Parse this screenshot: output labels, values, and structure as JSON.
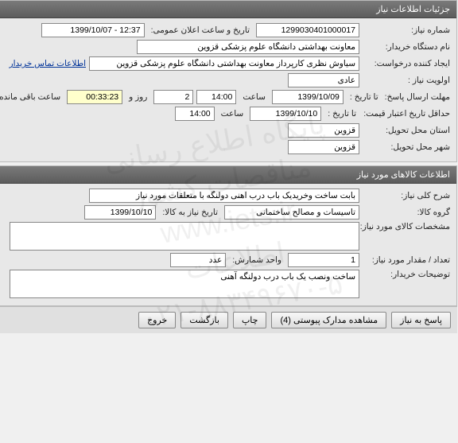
{
  "panel1": {
    "title": "جزئیات اطلاعات نیاز",
    "need_no_label": "شماره نیاز:",
    "need_no": "1299030401000017",
    "announce_date_label": "تاریخ و ساعت اعلان عمومی:",
    "announce_date": "12:37 - 1399/10/07",
    "buyer_label": "نام دستگاه خریدار:",
    "buyer": "معاونت بهداشتی دانشگاه علوم پزشکی قزوین",
    "creator_label": "ایجاد کننده درخواست:",
    "creator": "سیاوش نظری کارپرداز معاونت بهداشتی دانشگاه علوم پزشکی قزوین",
    "contact_link": "اطلاعات تماس خریدار",
    "priority_label": "اولویت نیاز :",
    "priority": "عادی",
    "deadline_label": "مهلت ارسال پاسخ:",
    "until_label": "تا تاریخ :",
    "deadline_date": "1399/10/09",
    "time_label": "ساعت",
    "deadline_time": "14:00",
    "days_remaining": "2",
    "days_and_label": "روز و",
    "time_remaining": "00:33:23",
    "remaining_label": "ساعت باقی مانده",
    "min_validity_label": "حداقل تاریخ اعتبار قیمت:",
    "min_validity_date": "1399/10/10",
    "min_validity_time": "14:00",
    "delivery_prov_label": "استان محل تحویل:",
    "delivery_prov": "قزوین",
    "delivery_city_label": "شهر محل تحویل:",
    "delivery_city": "قزوین"
  },
  "panel2": {
    "title": "اطلاعات کالاهای مورد نیاز",
    "general_desc_label": "شرح کلی نیاز:",
    "general_desc": "بابت ساخت وخریدیک باب درب آهنی دولنگه با متعلقات مورد نیاز",
    "group_label": "گروه کالا:",
    "group": "تاسیسات و مصالح ساختمانی",
    "need_date_label": "تاریخ نیاز به کالا:",
    "need_date": "1399/10/10",
    "spec_label": "مشخصات کالای مورد نیاز:",
    "spec": "",
    "qty_label": "تعداد / مقدار مورد نیاز:",
    "qty": "1",
    "unit_label": "واحد شمارش:",
    "unit": "عدد",
    "buyer_notes_label": "توضیحات خریدار:",
    "buyer_notes": "ساخت ونصب یک باب درب دولنگه آهنی"
  },
  "footer": {
    "respond": "پاسخ به نیاز",
    "attachments": "مشاهده مدارک پیوستی (4)",
    "print": "چاپ",
    "back": "بازگشت",
    "exit": "خروج"
  },
  "watermark": {
    "l1": "پایگاه اطلاع رسانی مناقصات کشور",
    "l2": "www.iets.ir اطلاعات",
    "l3": "۰۲۱-۸۸۳۴۹۶۷۰-۵"
  }
}
